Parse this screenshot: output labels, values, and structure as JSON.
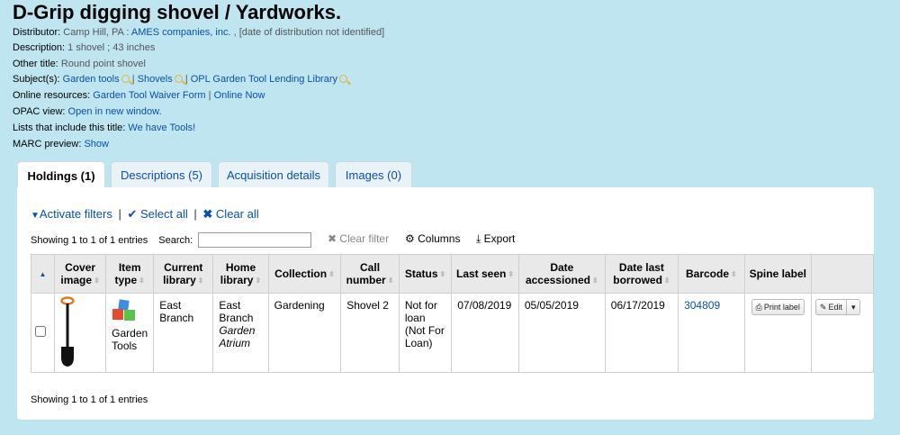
{
  "title": "D-Grip digging shovel / Yardworks.",
  "distributor": {
    "label": "Distributor:",
    "place": "Camp Hill, PA :",
    "name": "AMES companies, inc.",
    "date": ", [date of distribution not identified]"
  },
  "description": {
    "label": "Description:",
    "value": "1 shovel ; 43 inches"
  },
  "other_title": {
    "label": "Other title:",
    "value": "Round point shovel"
  },
  "subjects": {
    "label": "Subject(s):",
    "items": [
      "Garden tools",
      "Shovels",
      "OPL Garden Tool Lending Library"
    ],
    "sep": "|"
  },
  "online_resources": {
    "label": "Online resources:",
    "items": [
      "Garden Tool Waiver Form",
      "Online Now"
    ],
    "sep": "|"
  },
  "opac": {
    "label": "OPAC view:",
    "link": "Open in new window."
  },
  "lists": {
    "label": "Lists that include this title:",
    "link": "We have Tools!"
  },
  "marc": {
    "label": "MARC preview:",
    "link": "Show"
  },
  "tabs": [
    {
      "label": "Holdings (1)",
      "active": true
    },
    {
      "label": "Descriptions (5)"
    },
    {
      "label": "Acquisition details"
    },
    {
      "label": "Images (0)"
    }
  ],
  "toolbar": {
    "activate_filters": "Activate filters",
    "select_all": "Select all",
    "clear_all": "Clear all",
    "sep": "|"
  },
  "showing_top": "Showing 1 to 1 of 1 entries",
  "search_label": "Search:",
  "search_value": "",
  "clear_filter": "Clear filter",
  "columns": "Columns",
  "export": "Export",
  "table": {
    "headers": [
      "Cover image",
      "Item type",
      "Current library",
      "Home library",
      "Collection",
      "Call number",
      "Status",
      "Last seen",
      "Date accessioned",
      "Date last borrowed",
      "Barcode",
      "Spine label"
    ],
    "row": {
      "item_type": "Garden Tools",
      "current_library": "East Branch",
      "home_library": "East Branch",
      "home_location": "Garden Atrium",
      "collection": "Gardening",
      "call_number": "Shovel 2",
      "status": "Not for loan (Not For Loan)",
      "last_seen": "07/08/2019",
      "date_accessioned": "05/05/2019",
      "date_last_borrowed": "06/17/2019",
      "barcode": "304809",
      "print_label": "Print label",
      "edit": "Edit"
    }
  },
  "showing_bottom": "Showing 1 to 1 of 1 entries",
  "colors": {
    "link": "#0a4ea8",
    "background": "#bfe5f1",
    "shovel_handle": "#e07b22"
  }
}
